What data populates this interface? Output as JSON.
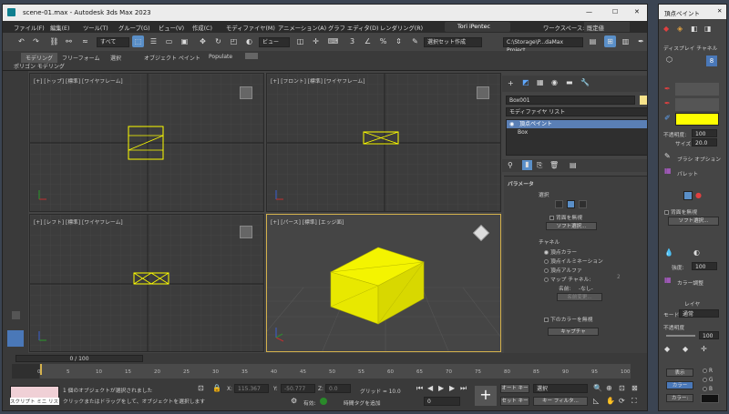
{
  "titlebar": {
    "title": "scene-01.max - Autodesk 3ds Max 2023",
    "minimize": "—",
    "maximize": "☐",
    "close": "✕"
  },
  "menu": [
    "ファイル(F)",
    "編集(E)",
    "ツール(T)",
    "グループ(G)",
    "ビュー(V)",
    "作成(C)",
    "モディファイヤ(M)",
    "アニメーション(A)",
    "グラフ エディタ(D)",
    "レンダリング(R)"
  ],
  "toolbar": {
    "selection_filter": "すべて",
    "view_dropdown": "ビュー",
    "named_sel": "選択セット作成",
    "user": "Tori iPentec",
    "workspace_label": "ワークスペース:",
    "workspace": "既定値",
    "path": "C:\\Storage\\P...daMax Project"
  },
  "ribbon": {
    "tabs": [
      "モデリング",
      "フリーフォーム",
      "選択",
      "オブジェクト ペイント",
      "Populate"
    ],
    "sub": "ポリゴン モデリング"
  },
  "viewports": {
    "top": "[+] [トップ] [標準] [ワイヤフレーム]",
    "front": "[+] [フロント] [標準] [ワイヤフレーム]",
    "left": "[+] [レフト] [標準] [ワイヤフレーム]",
    "persp": "[+] [パース] [標準] [エッジ面]"
  },
  "cmd": {
    "object_name": "Box001",
    "modifier_list": "モディファイヤ リスト",
    "stack_top": "頂点ペイント",
    "stack_base": "Box",
    "params_title": "パラメータ",
    "select_label": "選択",
    "ignore_back": "背面を無視",
    "soft_sel": "ソフト選択...",
    "channel_label": "チャネル",
    "channels": [
      "頂点カラー",
      "頂点イルミネーション",
      "頂点アルファ",
      "マップ チャネル:"
    ],
    "map_ch_value": "2",
    "name_label": "名前:",
    "name_value": "-なし-",
    "name_btn": "名前変更...",
    "opt_label": "下のカラーを無視",
    "capture": "キャプチャ"
  },
  "timeline": {
    "frame": "0 / 100",
    "ticks": [
      "0",
      "5",
      "10",
      "15",
      "20",
      "25",
      "30",
      "35",
      "40",
      "45",
      "50",
      "55",
      "60",
      "65",
      "70",
      "75",
      "80",
      "85",
      "90",
      "95",
      "100"
    ]
  },
  "status": {
    "script": "スクリプト ミニ リス",
    "msg1": "1 個のオブジェクトが選択されました",
    "msg2": "クリックまたはドラッグをして、オブジェクトを選択します",
    "x": "115.367",
    "y": "-50.777",
    "z": "0.0",
    "grid": "グリッド = 10.0",
    "autokey": "有効:",
    "addtime": "時間タグを追加",
    "keymode": "オート キー",
    "selected": "選択",
    "setkey": "セット キー",
    "keyfilter": "キー フィルタ...",
    "frame_field": "0"
  },
  "panel": {
    "title": "頂点ペイント",
    "display_ch": "ディスプレイ チャネル",
    "opacity_label": "不透明度:",
    "opacity": "100",
    "size_label": "サイズ:",
    "size": "20.0",
    "brush_opt": "ブラシ オプション",
    "palette": "パレット",
    "ignore_back": "背面を無視",
    "soft_sel": "ソフト選択...",
    "strength_label": "強度:",
    "strength": "100",
    "color_adjust": "カラー調整",
    "layer_title": "レイヤ",
    "mode_label": "モード:",
    "mode": "通常",
    "opacity2_label": "不透明度",
    "opacity2": "100",
    "display": "表示",
    "opt_r": "R",
    "opt_g": "G",
    "opt_b": "B",
    "channel_btn": "カラー",
    "color_btn": "カラー:"
  },
  "colors": {
    "accent": "#4a8fd8",
    "selection": "#ffff00",
    "yellow_box": "#f0f000"
  }
}
